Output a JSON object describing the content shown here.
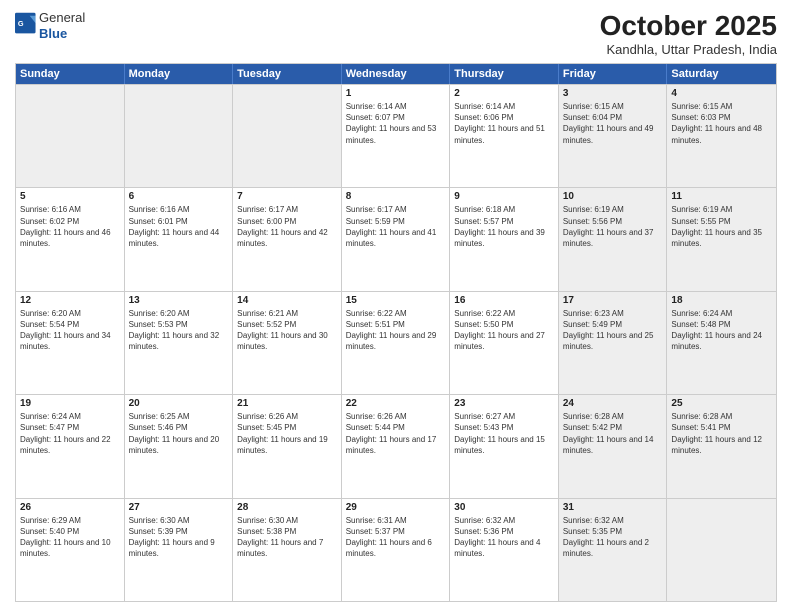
{
  "header": {
    "logo_general": "General",
    "logo_blue": "Blue",
    "month": "October 2025",
    "location": "Kandhla, Uttar Pradesh, India"
  },
  "weekdays": [
    "Sunday",
    "Monday",
    "Tuesday",
    "Wednesday",
    "Thursday",
    "Friday",
    "Saturday"
  ],
  "rows": [
    [
      {
        "day": "",
        "sunrise": "",
        "sunset": "",
        "daylight": "",
        "shaded": true
      },
      {
        "day": "",
        "sunrise": "",
        "sunset": "",
        "daylight": "",
        "shaded": true
      },
      {
        "day": "",
        "sunrise": "",
        "sunset": "",
        "daylight": "",
        "shaded": true
      },
      {
        "day": "1",
        "sunrise": "Sunrise: 6:14 AM",
        "sunset": "Sunset: 6:07 PM",
        "daylight": "Daylight: 11 hours and 53 minutes.",
        "shaded": false
      },
      {
        "day": "2",
        "sunrise": "Sunrise: 6:14 AM",
        "sunset": "Sunset: 6:06 PM",
        "daylight": "Daylight: 11 hours and 51 minutes.",
        "shaded": false
      },
      {
        "day": "3",
        "sunrise": "Sunrise: 6:15 AM",
        "sunset": "Sunset: 6:04 PM",
        "daylight": "Daylight: 11 hours and 49 minutes.",
        "shaded": true
      },
      {
        "day": "4",
        "sunrise": "Sunrise: 6:15 AM",
        "sunset": "Sunset: 6:03 PM",
        "daylight": "Daylight: 11 hours and 48 minutes.",
        "shaded": true
      }
    ],
    [
      {
        "day": "5",
        "sunrise": "Sunrise: 6:16 AM",
        "sunset": "Sunset: 6:02 PM",
        "daylight": "Daylight: 11 hours and 46 minutes.",
        "shaded": false
      },
      {
        "day": "6",
        "sunrise": "Sunrise: 6:16 AM",
        "sunset": "Sunset: 6:01 PM",
        "daylight": "Daylight: 11 hours and 44 minutes.",
        "shaded": false
      },
      {
        "day": "7",
        "sunrise": "Sunrise: 6:17 AM",
        "sunset": "Sunset: 6:00 PM",
        "daylight": "Daylight: 11 hours and 42 minutes.",
        "shaded": false
      },
      {
        "day": "8",
        "sunrise": "Sunrise: 6:17 AM",
        "sunset": "Sunset: 5:59 PM",
        "daylight": "Daylight: 11 hours and 41 minutes.",
        "shaded": false
      },
      {
        "day": "9",
        "sunrise": "Sunrise: 6:18 AM",
        "sunset": "Sunset: 5:57 PM",
        "daylight": "Daylight: 11 hours and 39 minutes.",
        "shaded": false
      },
      {
        "day": "10",
        "sunrise": "Sunrise: 6:19 AM",
        "sunset": "Sunset: 5:56 PM",
        "daylight": "Daylight: 11 hours and 37 minutes.",
        "shaded": true
      },
      {
        "day": "11",
        "sunrise": "Sunrise: 6:19 AM",
        "sunset": "Sunset: 5:55 PM",
        "daylight": "Daylight: 11 hours and 35 minutes.",
        "shaded": true
      }
    ],
    [
      {
        "day": "12",
        "sunrise": "Sunrise: 6:20 AM",
        "sunset": "Sunset: 5:54 PM",
        "daylight": "Daylight: 11 hours and 34 minutes.",
        "shaded": false
      },
      {
        "day": "13",
        "sunrise": "Sunrise: 6:20 AM",
        "sunset": "Sunset: 5:53 PM",
        "daylight": "Daylight: 11 hours and 32 minutes.",
        "shaded": false
      },
      {
        "day": "14",
        "sunrise": "Sunrise: 6:21 AM",
        "sunset": "Sunset: 5:52 PM",
        "daylight": "Daylight: 11 hours and 30 minutes.",
        "shaded": false
      },
      {
        "day": "15",
        "sunrise": "Sunrise: 6:22 AM",
        "sunset": "Sunset: 5:51 PM",
        "daylight": "Daylight: 11 hours and 29 minutes.",
        "shaded": false
      },
      {
        "day": "16",
        "sunrise": "Sunrise: 6:22 AM",
        "sunset": "Sunset: 5:50 PM",
        "daylight": "Daylight: 11 hours and 27 minutes.",
        "shaded": false
      },
      {
        "day": "17",
        "sunrise": "Sunrise: 6:23 AM",
        "sunset": "Sunset: 5:49 PM",
        "daylight": "Daylight: 11 hours and 25 minutes.",
        "shaded": true
      },
      {
        "day": "18",
        "sunrise": "Sunrise: 6:24 AM",
        "sunset": "Sunset: 5:48 PM",
        "daylight": "Daylight: 11 hours and 24 minutes.",
        "shaded": true
      }
    ],
    [
      {
        "day": "19",
        "sunrise": "Sunrise: 6:24 AM",
        "sunset": "Sunset: 5:47 PM",
        "daylight": "Daylight: 11 hours and 22 minutes.",
        "shaded": false
      },
      {
        "day": "20",
        "sunrise": "Sunrise: 6:25 AM",
        "sunset": "Sunset: 5:46 PM",
        "daylight": "Daylight: 11 hours and 20 minutes.",
        "shaded": false
      },
      {
        "day": "21",
        "sunrise": "Sunrise: 6:26 AM",
        "sunset": "Sunset: 5:45 PM",
        "daylight": "Daylight: 11 hours and 19 minutes.",
        "shaded": false
      },
      {
        "day": "22",
        "sunrise": "Sunrise: 6:26 AM",
        "sunset": "Sunset: 5:44 PM",
        "daylight": "Daylight: 11 hours and 17 minutes.",
        "shaded": false
      },
      {
        "day": "23",
        "sunrise": "Sunrise: 6:27 AM",
        "sunset": "Sunset: 5:43 PM",
        "daylight": "Daylight: 11 hours and 15 minutes.",
        "shaded": false
      },
      {
        "day": "24",
        "sunrise": "Sunrise: 6:28 AM",
        "sunset": "Sunset: 5:42 PM",
        "daylight": "Daylight: 11 hours and 14 minutes.",
        "shaded": true
      },
      {
        "day": "25",
        "sunrise": "Sunrise: 6:28 AM",
        "sunset": "Sunset: 5:41 PM",
        "daylight": "Daylight: 11 hours and 12 minutes.",
        "shaded": true
      }
    ],
    [
      {
        "day": "26",
        "sunrise": "Sunrise: 6:29 AM",
        "sunset": "Sunset: 5:40 PM",
        "daylight": "Daylight: 11 hours and 10 minutes.",
        "shaded": false
      },
      {
        "day": "27",
        "sunrise": "Sunrise: 6:30 AM",
        "sunset": "Sunset: 5:39 PM",
        "daylight": "Daylight: 11 hours and 9 minutes.",
        "shaded": false
      },
      {
        "day": "28",
        "sunrise": "Sunrise: 6:30 AM",
        "sunset": "Sunset: 5:38 PM",
        "daylight": "Daylight: 11 hours and 7 minutes.",
        "shaded": false
      },
      {
        "day": "29",
        "sunrise": "Sunrise: 6:31 AM",
        "sunset": "Sunset: 5:37 PM",
        "daylight": "Daylight: 11 hours and 6 minutes.",
        "shaded": false
      },
      {
        "day": "30",
        "sunrise": "Sunrise: 6:32 AM",
        "sunset": "Sunset: 5:36 PM",
        "daylight": "Daylight: 11 hours and 4 minutes.",
        "shaded": false
      },
      {
        "day": "31",
        "sunrise": "Sunrise: 6:32 AM",
        "sunset": "Sunset: 5:35 PM",
        "daylight": "Daylight: 11 hours and 2 minutes.",
        "shaded": true
      },
      {
        "day": "",
        "sunrise": "",
        "sunset": "",
        "daylight": "",
        "shaded": true
      }
    ]
  ]
}
